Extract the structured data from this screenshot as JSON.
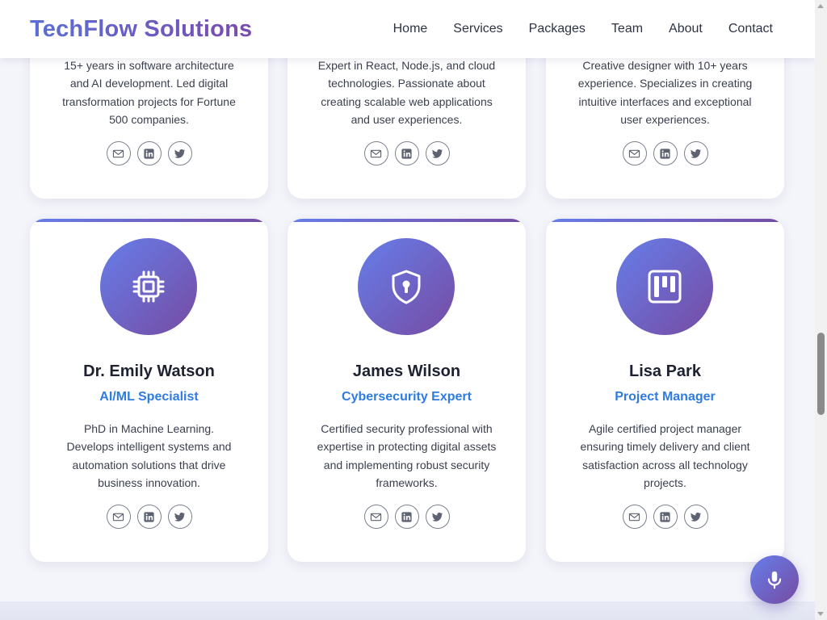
{
  "nav": {
    "brand": "TechFlow Solutions",
    "links": [
      "Home",
      "Services",
      "Packages",
      "Team",
      "About",
      "Contact"
    ]
  },
  "team": [
    {
      "name": "",
      "role": "",
      "bio": "15+ years in software architecture and AI development. Led digital transformation projects for Fortune 500 companies.",
      "icon": "user-icon"
    },
    {
      "name": "",
      "role": "",
      "bio": "Expert in React, Node.js, and cloud technologies. Passionate about creating scalable web applications and user experiences.",
      "icon": "code-icon"
    },
    {
      "name": "",
      "role": "",
      "bio": "Creative designer with 10+ years experience. Specializes in creating intuitive interfaces and exceptional user experiences.",
      "icon": "palette-icon"
    },
    {
      "name": "Dr. Emily Watson",
      "role": "AI/ML Specialist",
      "bio": "PhD in Machine Learning. Develops intelligent systems and automation solutions that drive business innovation.",
      "icon": "chip-icon"
    },
    {
      "name": "James Wilson",
      "role": "Cybersecurity Expert",
      "bio": "Certified security professional with expertise in protecting digital assets and implementing robust security frameworks.",
      "icon": "shield-lock-icon"
    },
    {
      "name": "Lisa Park",
      "role": "Project Manager",
      "bio": "Agile certified project manager ensuring timely delivery and client satisfaction across all technology projects.",
      "icon": "kanban-icon"
    }
  ],
  "social_icons": [
    "envelope-icon",
    "linkedin-icon",
    "twitter-icon"
  ],
  "fab": {
    "icon": "microphone-icon"
  },
  "colors": {
    "gradient_start": "#667eea",
    "gradient_end": "#764ba2",
    "role_color": "#2f7be0"
  }
}
